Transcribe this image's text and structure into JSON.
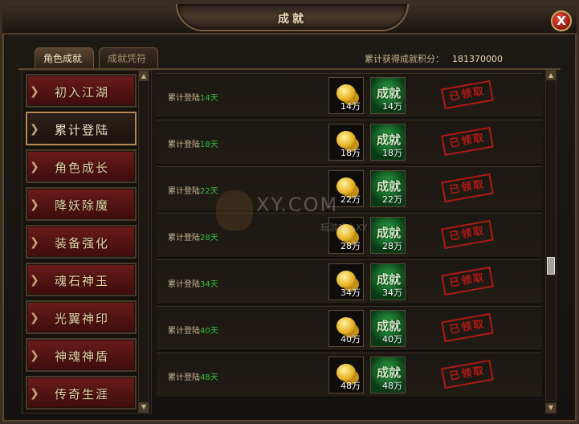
{
  "window": {
    "title": "成就",
    "close_label": "X"
  },
  "tabs": [
    {
      "label": "角色成就",
      "active": true
    },
    {
      "label": "成就凭符",
      "active": false
    }
  ],
  "score": {
    "label": "累计获得成就积分：",
    "value": "181370000"
  },
  "sidebar": {
    "items": [
      {
        "label": "初入江湖",
        "selected": false
      },
      {
        "label": "累计登陆",
        "selected": true
      },
      {
        "label": "角色成长",
        "selected": false
      },
      {
        "label": "降妖除魔",
        "selected": false
      },
      {
        "label": "装备强化",
        "selected": false
      },
      {
        "label": "魂石神玉",
        "selected": false
      },
      {
        "label": "光翼神印",
        "selected": false
      },
      {
        "label": "神魂神盾",
        "selected": false
      },
      {
        "label": "传奇生涯",
        "selected": false
      }
    ]
  },
  "achievements": [
    {
      "prefix": "累计登陆",
      "days": "14天",
      "gold_qty": "14万",
      "ach_label": "成就",
      "ach_qty": "14万",
      "status": "已领取"
    },
    {
      "prefix": "累计登陆",
      "days": "18天",
      "gold_qty": "18万",
      "ach_label": "成就",
      "ach_qty": "18万",
      "status": "已领取"
    },
    {
      "prefix": "累计登陆",
      "days": "22天",
      "gold_qty": "22万",
      "ach_label": "成就",
      "ach_qty": "22万",
      "status": "已领取"
    },
    {
      "prefix": "累计登陆",
      "days": "28天",
      "gold_qty": "28万",
      "ach_label": "成就",
      "ach_qty": "28万",
      "status": "已领取"
    },
    {
      "prefix": "累计登陆",
      "days": "34天",
      "gold_qty": "34万",
      "ach_label": "成就",
      "ach_qty": "34万",
      "status": "已领取"
    },
    {
      "prefix": "累计登陆",
      "days": "40天",
      "gold_qty": "40万",
      "ach_label": "成就",
      "ach_qty": "40万",
      "status": "已领取"
    },
    {
      "prefix": "累计登陆",
      "days": "48天",
      "gold_qty": "48万",
      "ach_label": "成就",
      "ach_qty": "48万",
      "status": "已领取"
    }
  ],
  "watermark": {
    "text": "XY.COM",
    "sub": "玩游戏上XY"
  },
  "colors": {
    "accent_red": "#c21b15",
    "days_green": "#35c43a",
    "gold": "#e7b323"
  }
}
